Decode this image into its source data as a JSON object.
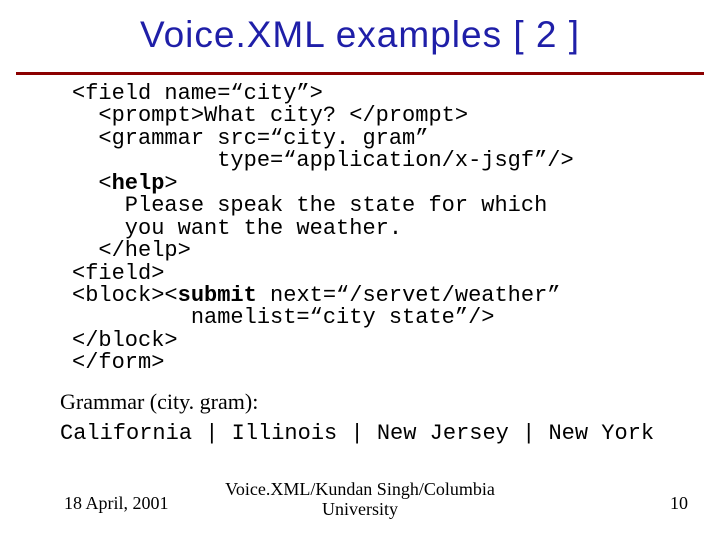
{
  "title": "Voice.XML examples [ 2 ]",
  "code": {
    "l1": "<field name=“city”>",
    "l2": "  <prompt>What city? </prompt>",
    "l3": "  <grammar src=“city. gram”",
    "l4": "           type=“application/x-jsgf”/>",
    "l5a": "  <",
    "l5b": "help",
    "l5c": ">",
    "l6": "    Please speak the state for which",
    "l7": "    you want the weather.",
    "l8": "  </help>",
    "l9": "<field>",
    "l10a": "<block><",
    "l10b": "submit",
    "l10c": " next=“/servet/weather”",
    "l11": "         namelist=“city state”/>",
    "l12": "</block>",
    "l13": "</form>"
  },
  "grammar_label": "Grammar (city. gram):",
  "grammar_line": "California | Illinois | New Jersey | New York",
  "footer": {
    "date": "18 April, 2001",
    "center": "Voice.XML/Kundan Singh/Columbia\nUniversity",
    "page": "10"
  }
}
